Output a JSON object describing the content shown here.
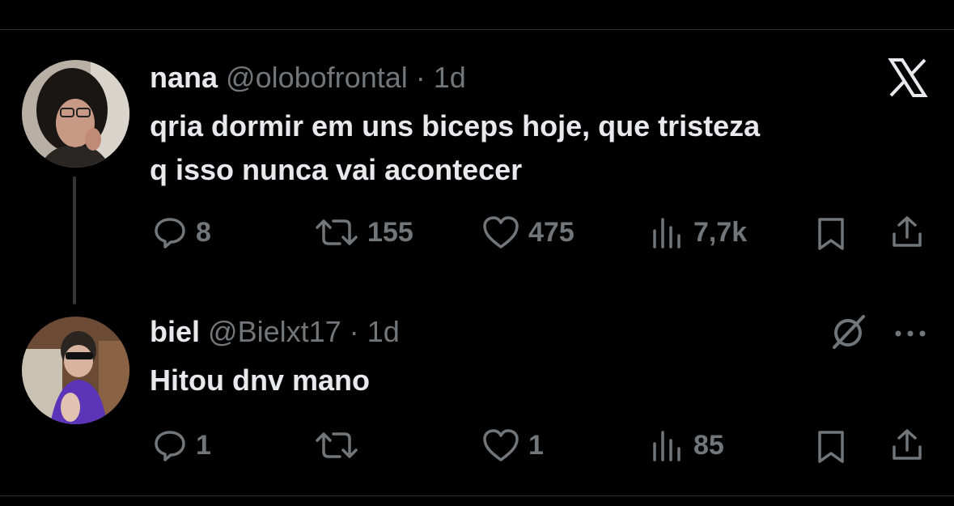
{
  "tweet": {
    "name": "nana",
    "handle": "@olobofrontal",
    "separator": "·",
    "time": "1d",
    "text_line1": "qria dormir em uns biceps hoje, que tristeza",
    "text_line2": "q isso nunca vai acontecer",
    "replies": "8",
    "reposts": "155",
    "likes": "475",
    "views": "7,7k",
    "close_icon": "x-logo-icon"
  },
  "reply": {
    "name": "biel",
    "handle": "@Bielxt17",
    "separator": "·",
    "time": "1d",
    "text": "Hitou dnv mano",
    "replies": "1",
    "reposts": "",
    "likes": "1",
    "views": "85",
    "grok_icon": "grok-icon",
    "more_icon": "more-dots-icon"
  },
  "colors": {
    "background": "#000000",
    "text_primary": "#e7e9ea",
    "text_secondary": "#71767b",
    "divider": "#2f3336"
  }
}
